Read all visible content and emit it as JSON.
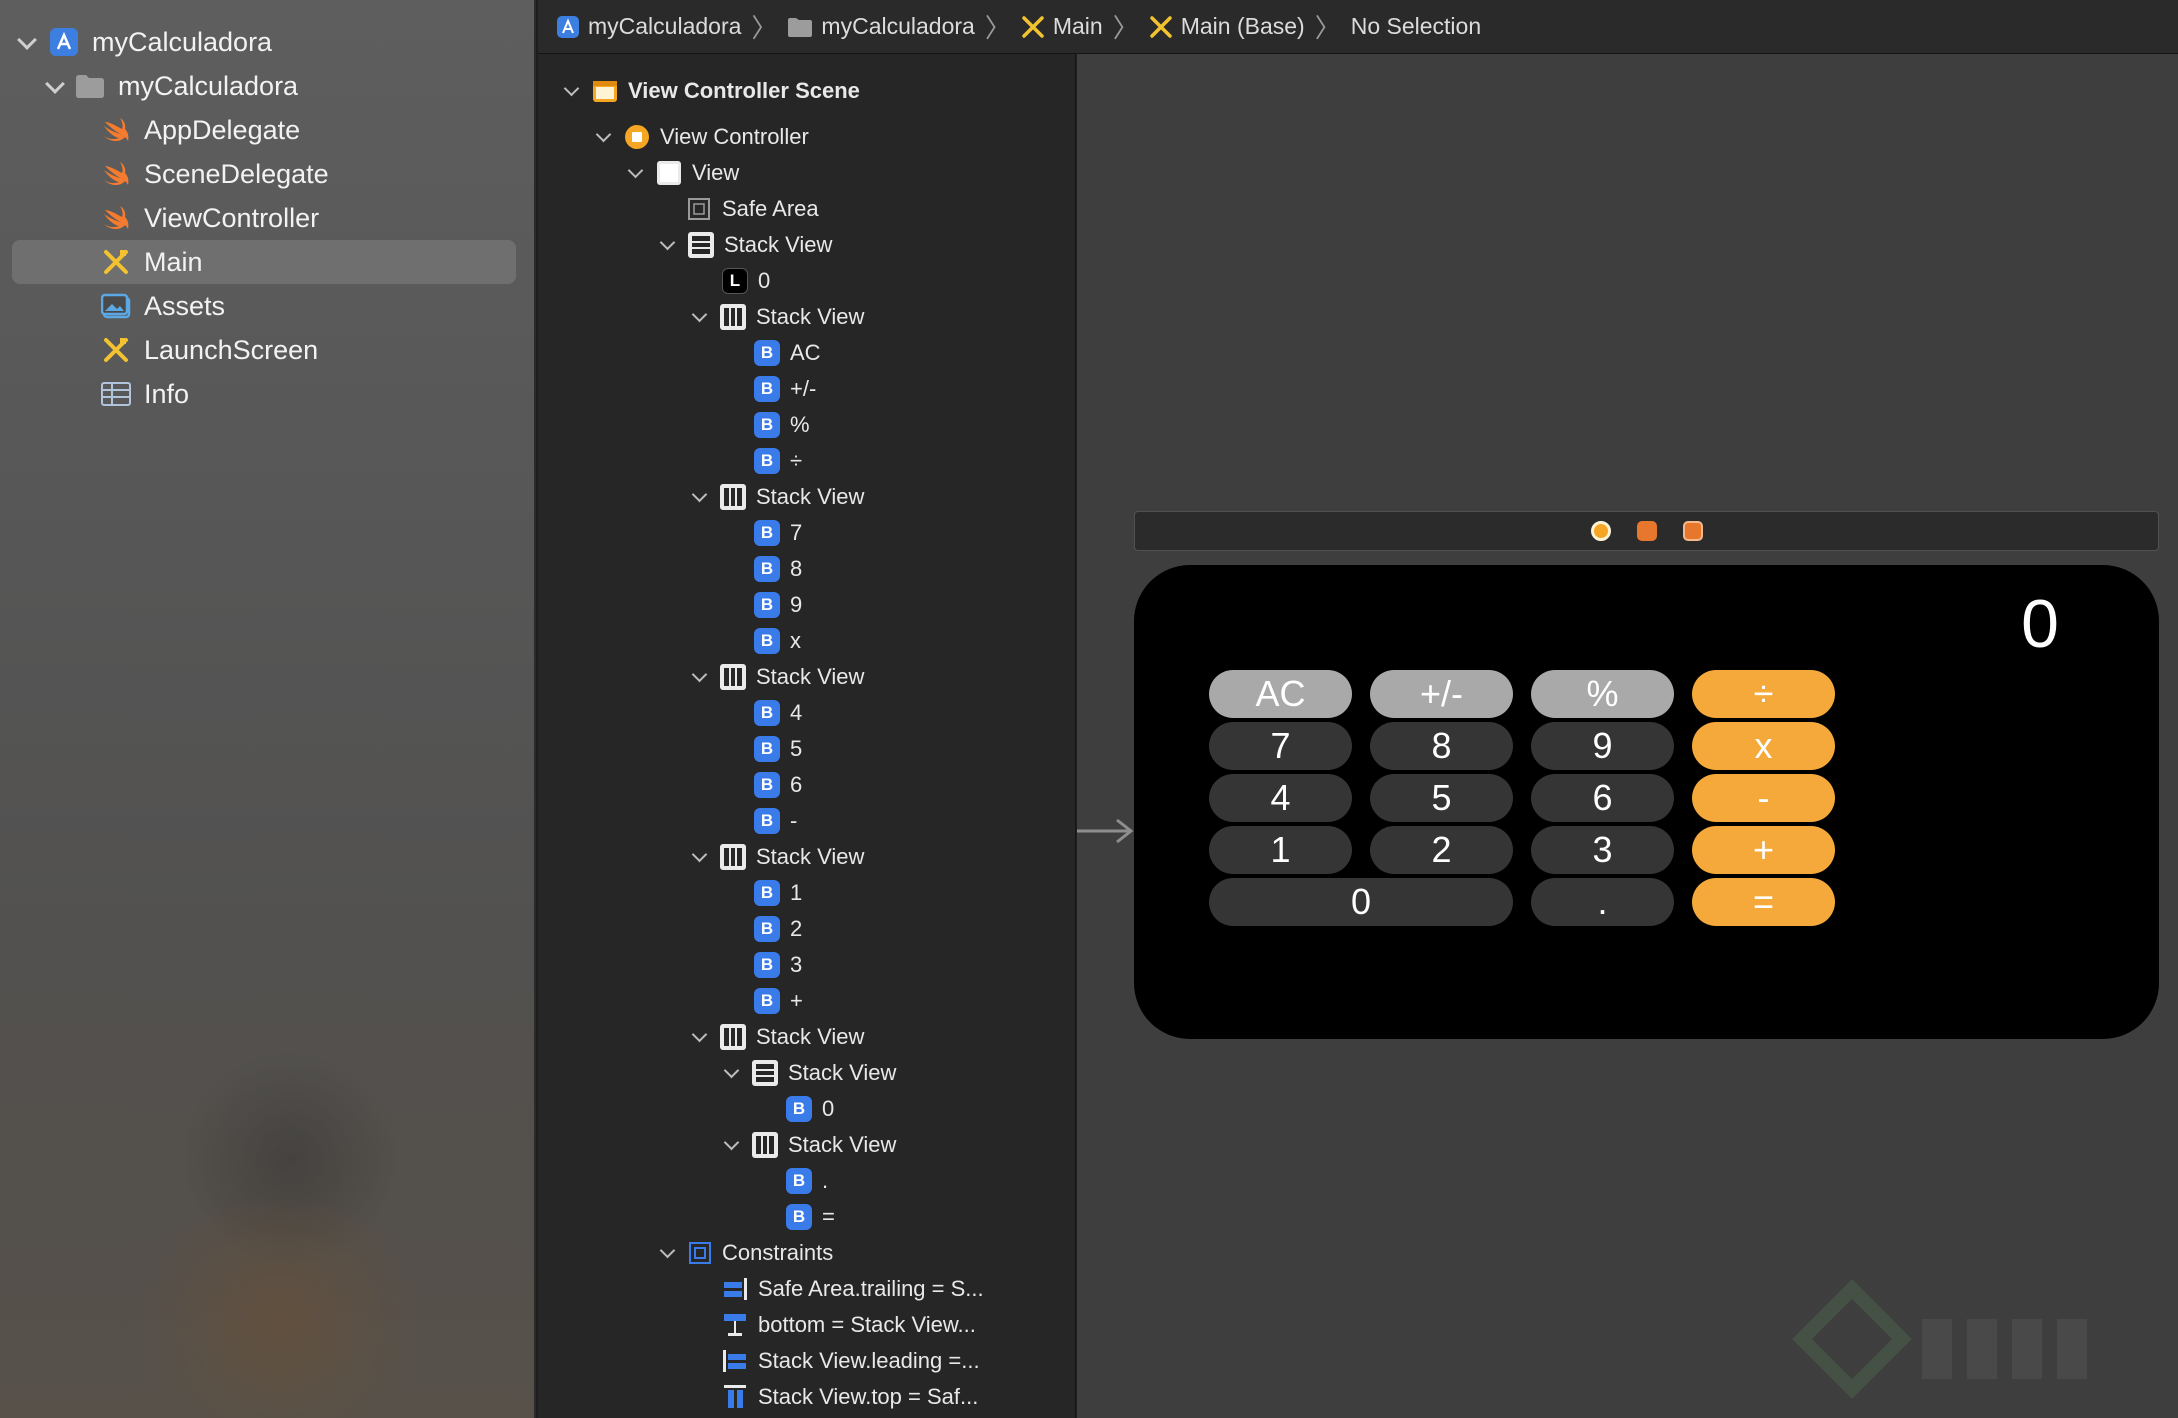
{
  "navigator": {
    "project": "myCalculadora",
    "group": "myCalculadora",
    "files": [
      {
        "label": "AppDelegate",
        "icon": "swift-file-icon"
      },
      {
        "label": "SceneDelegate",
        "icon": "swift-file-icon"
      },
      {
        "label": "ViewController",
        "icon": "swift-file-icon"
      },
      {
        "label": "Main",
        "icon": "storyboard-icon",
        "selected": true
      },
      {
        "label": "Assets",
        "icon": "asset-catalog-icon"
      },
      {
        "label": "LaunchScreen",
        "icon": "storyboard-icon"
      },
      {
        "label": "Info",
        "icon": "plist-icon"
      }
    ]
  },
  "jumpbar": {
    "crumbs": [
      "myCalculadora",
      "myCalculadora",
      "Main",
      "Main (Base)",
      "No Selection"
    ]
  },
  "outline": {
    "scene": "View Controller Scene",
    "view_controller": "View Controller",
    "view": "View",
    "safe_area": "Safe Area",
    "stack_view": "Stack View",
    "label_badge": "L",
    "button_badge": "B",
    "label_value": "0",
    "rows": [
      [
        "AC",
        "+/-",
        "%",
        "÷"
      ],
      [
        "7",
        "8",
        "9",
        "x"
      ],
      [
        "4",
        "5",
        "6",
        "-"
      ],
      [
        "1",
        "2",
        "3",
        "+"
      ]
    ],
    "last_row": {
      "zero": "0",
      "dot": ".",
      "equals": "="
    },
    "constraints_label": "Constraints",
    "constraints": [
      "Safe Area.trailing = S...",
      "bottom = Stack View...",
      "Stack View.leading =...",
      "Stack View.top = Saf..."
    ]
  },
  "calculator": {
    "display": "0",
    "keys": [
      [
        "AC",
        "+/-",
        "%",
        "÷"
      ],
      [
        "7",
        "8",
        "9",
        "x"
      ],
      [
        "4",
        "5",
        "6",
        "-"
      ],
      [
        "1",
        "2",
        "3",
        "+"
      ]
    ],
    "bottom": {
      "zero": "0",
      "dot": ".",
      "equals": "="
    }
  },
  "colors": {
    "operator": "#f4a93a",
    "function": "#a9a9a9",
    "digit": "#353535",
    "badge_button": "#3a7bea"
  }
}
